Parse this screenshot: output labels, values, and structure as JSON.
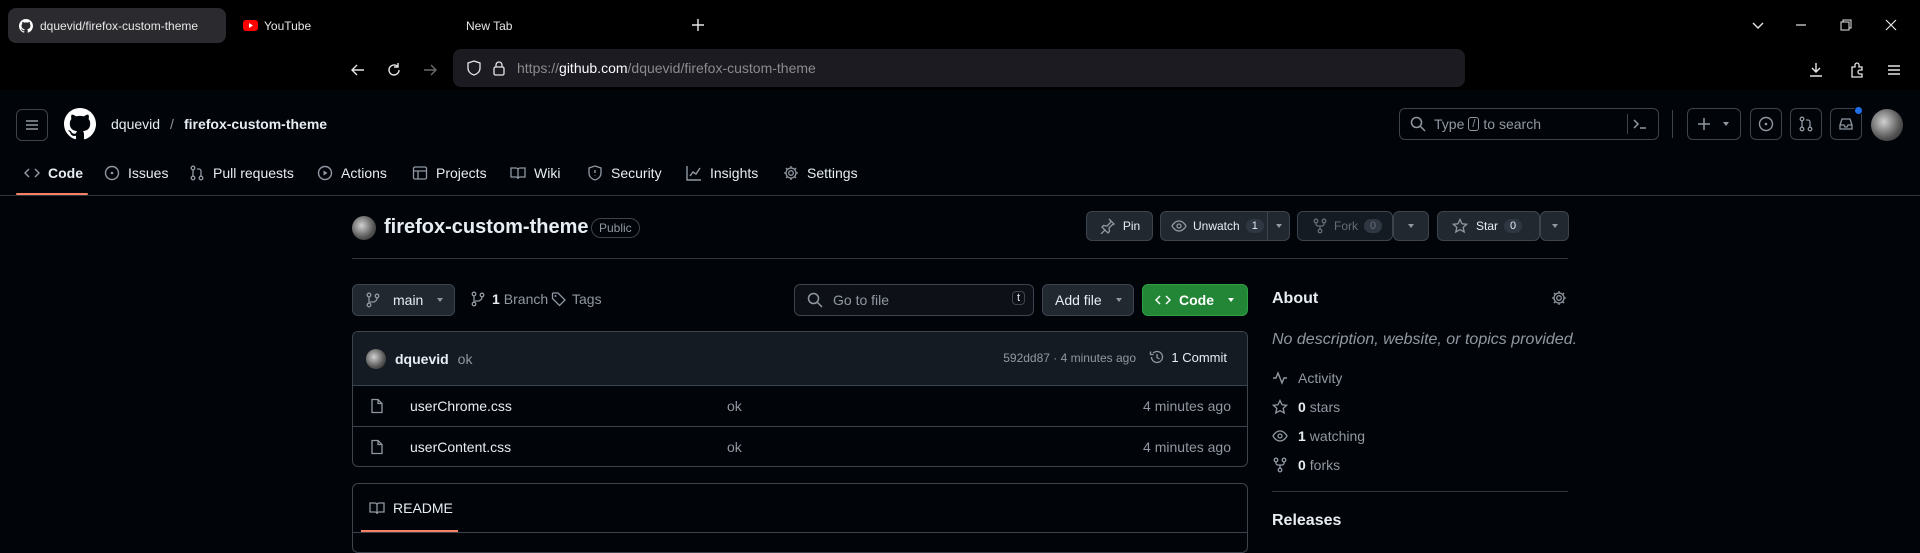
{
  "browser": {
    "tabs": [
      {
        "title": "dquevid/firefox-custom-theme",
        "active": true
      },
      {
        "title": "YouTube",
        "active": false
      },
      {
        "title": "New Tab",
        "active": false
      }
    ],
    "url_prefix": "https://",
    "url_host": "github.com",
    "url_path": "/dquevid/firefox-custom-theme"
  },
  "github": {
    "owner": "dquevid",
    "separator": "/",
    "repo": "firefox-custom-theme",
    "search": {
      "prefix": "Type",
      "key": "/",
      "suffix": "to search"
    },
    "nav_tabs": [
      "Code",
      "Issues",
      "Pull requests",
      "Actions",
      "Projects",
      "Wiki",
      "Security",
      "Insights",
      "Settings"
    ]
  },
  "repo": {
    "name": "firefox-custom-theme",
    "visibility": "Public",
    "pin_label": "Pin",
    "watch_label": "Unwatch",
    "watch_count": "1",
    "fork_label": "Fork",
    "fork_count": "0",
    "star_label": "Star",
    "star_count": "0",
    "branch_label": "main",
    "branch_count": "1",
    "branch_word": "Branch",
    "tags_label": "Tags",
    "goto_placeholder": "Go to file",
    "goto_key": "t",
    "add_file_label": "Add file",
    "code_label": "Code",
    "commit": {
      "author": "dquevid",
      "message": "ok",
      "sha_time": "592dd87 · 4 minutes ago",
      "count_label": "1 Commit"
    },
    "files": [
      {
        "name": "userChrome.css",
        "message": "ok",
        "time": "4 minutes ago"
      },
      {
        "name": "userContent.css",
        "message": "ok",
        "time": "4 minutes ago"
      }
    ],
    "readme_label": "README"
  },
  "about": {
    "title": "About",
    "description": "No description, website, or topics provided.",
    "activity": "Activity",
    "stars": {
      "count": "0",
      "label": "stars"
    },
    "watching": {
      "count": "1",
      "label": "watching"
    },
    "forks": {
      "count": "0",
      "label": "forks"
    },
    "releases_title": "Releases"
  },
  "colors": {
    "accent": "#f78166",
    "green": "#238636",
    "link": "#4493f8",
    "notification": "#1f6feb"
  }
}
